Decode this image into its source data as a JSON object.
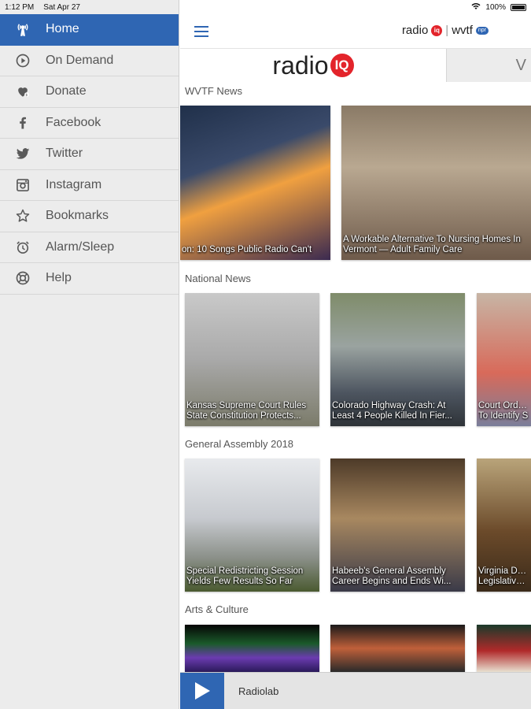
{
  "status": {
    "time": "1:12 PM",
    "date": "Sat Apr 27",
    "battery": "100%"
  },
  "menu": [
    {
      "label": "Home",
      "icon": "radio-tower-icon"
    },
    {
      "label": "On Demand",
      "icon": "play-circle-icon"
    },
    {
      "label": "Donate",
      "icon": "heart-icon"
    },
    {
      "label": "Facebook",
      "icon": "facebook-icon"
    },
    {
      "label": "Twitter",
      "icon": "twitter-icon"
    },
    {
      "label": "Instagram",
      "icon": "instagram-icon"
    },
    {
      "label": "Bookmarks",
      "icon": "star-icon"
    },
    {
      "label": "Alarm/Sleep",
      "icon": "alarm-clock-icon"
    },
    {
      "label": "Help",
      "icon": "help-icon"
    }
  ],
  "header": {
    "logo_radio": "radio",
    "logo_iq": "iq",
    "logo_station": "wvtf",
    "logo_badge": "npr"
  },
  "stations": [
    {
      "label": "radio",
      "iq": "IQ"
    },
    {
      "label": "V"
    }
  ],
  "sections": [
    {
      "title": "WVTF News",
      "cards": [
        {
          "caption1": "on: 10 Songs Public Radio Can't",
          "caption2": ""
        },
        {
          "caption1": "A Workable Alternative To Nursing Homes In",
          "caption2": "Vermont — Adult Family Care"
        }
      ]
    },
    {
      "title": "National News",
      "cards": [
        {
          "caption1": "Kansas Supreme Court Rules",
          "caption2": "State Constitution Protects..."
        },
        {
          "caption1": "Colorado Highway Crash: At",
          "caption2": "Least 4 People Killed In Fier..."
        },
        {
          "caption1": "Court Orders",
          "caption2": "To Identify S"
        }
      ]
    },
    {
      "title": "General Assembly 2018",
      "cards": [
        {
          "caption1": "Special Redistricting Session",
          "caption2": "Yields Few Results So Far"
        },
        {
          "caption1": "Habeeb's General Assembly",
          "caption2": "Career Begins and Ends Wi..."
        },
        {
          "caption1": "Virginia Dem",
          "caption2": "Legislative D"
        }
      ]
    },
    {
      "title": "Arts & Culture",
      "cards": [
        {
          "caption1": "",
          "caption2": ""
        },
        {
          "caption1": "",
          "caption2": ""
        },
        {
          "caption1": "",
          "caption2": ""
        }
      ]
    }
  ],
  "player": {
    "title": "Radiolab"
  }
}
